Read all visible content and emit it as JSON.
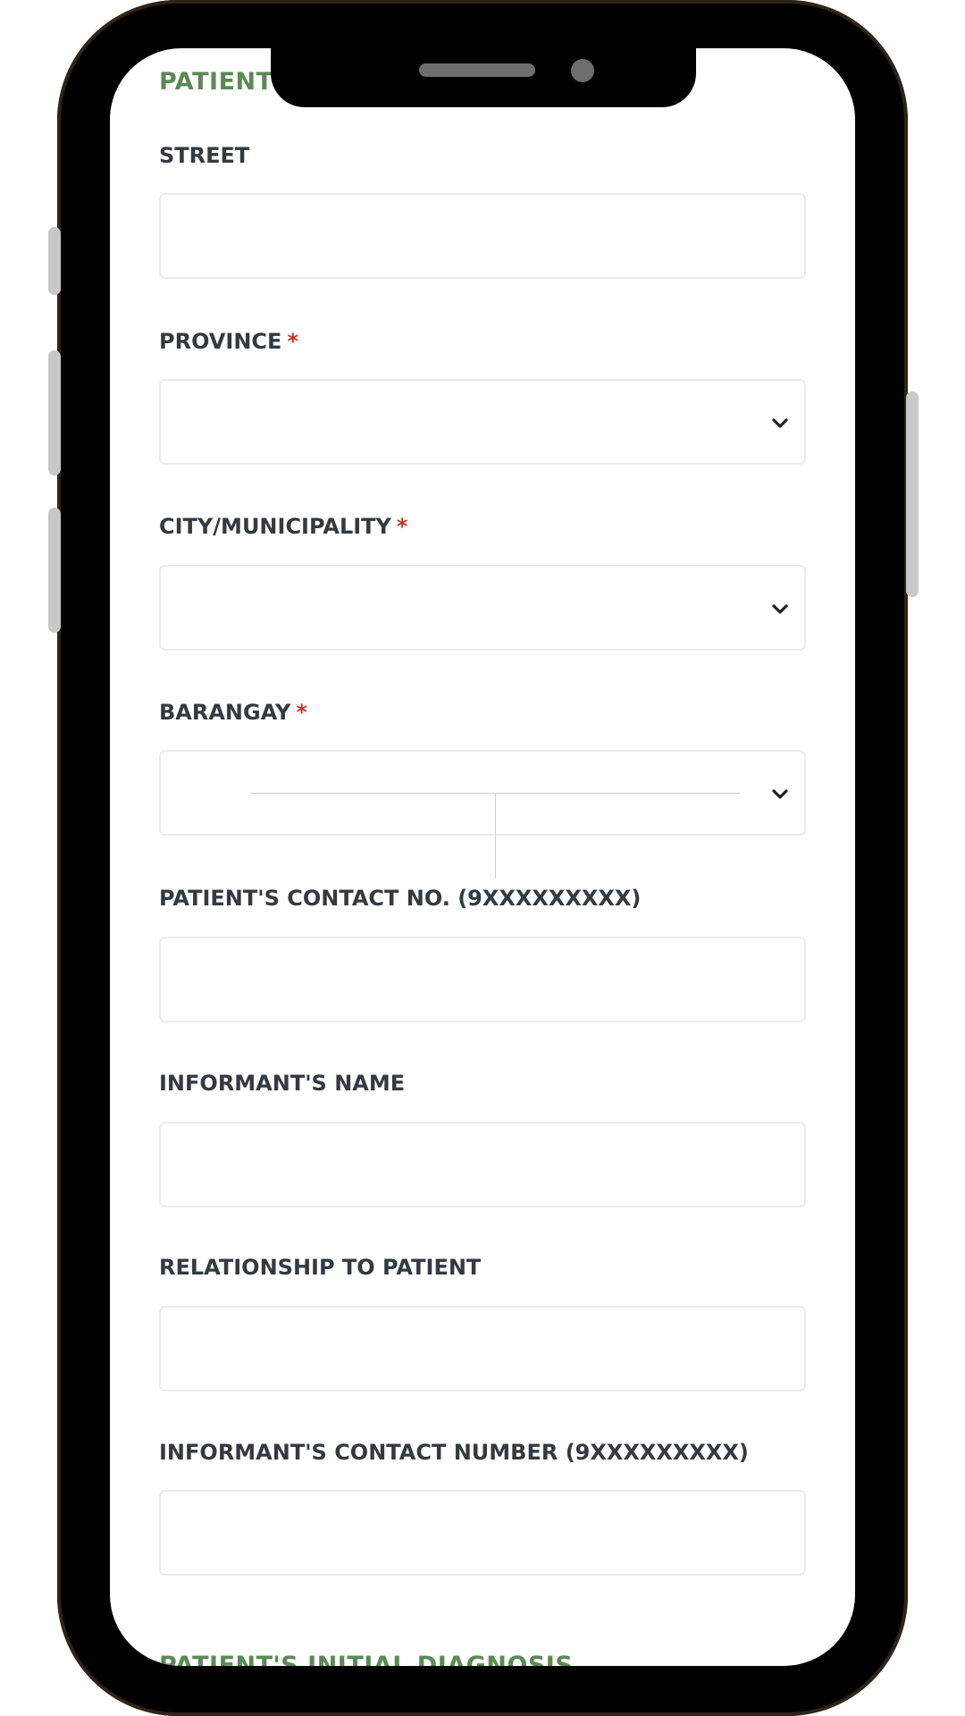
{
  "form": {
    "top_section_title": "PATIENT",
    "bottom_section_title": "PATIENT'S INITIAL DIAGNOSIS",
    "required_marker": "*",
    "fields": {
      "street": {
        "label": "STREET",
        "value": ""
      },
      "province": {
        "label": "PROVINCE",
        "value": ""
      },
      "city": {
        "label": "CITY/MUNICIPALITY",
        "value": ""
      },
      "barangay": {
        "label": "BARANGAY",
        "value": ""
      },
      "patient_contact": {
        "label": "PATIENT'S CONTACT NO. (9XXXXXXXXX)",
        "value": ""
      },
      "informant_name": {
        "label": "INFORMANT'S NAME",
        "value": ""
      },
      "relationship": {
        "label": "RELATIONSHIP TO PATIENT",
        "value": ""
      },
      "informant_contact": {
        "label": "INFORMANT'S CONTACT NUMBER (9XXXXXXXXX)",
        "value": ""
      }
    }
  },
  "colors": {
    "section_title": "#5a8a54",
    "label": "#333a40",
    "required": "#c0392b",
    "phone_frame": "#000000",
    "phone_bezel": "#2e2418"
  },
  "icons": {
    "dropdown": "chevron-down-icon"
  }
}
